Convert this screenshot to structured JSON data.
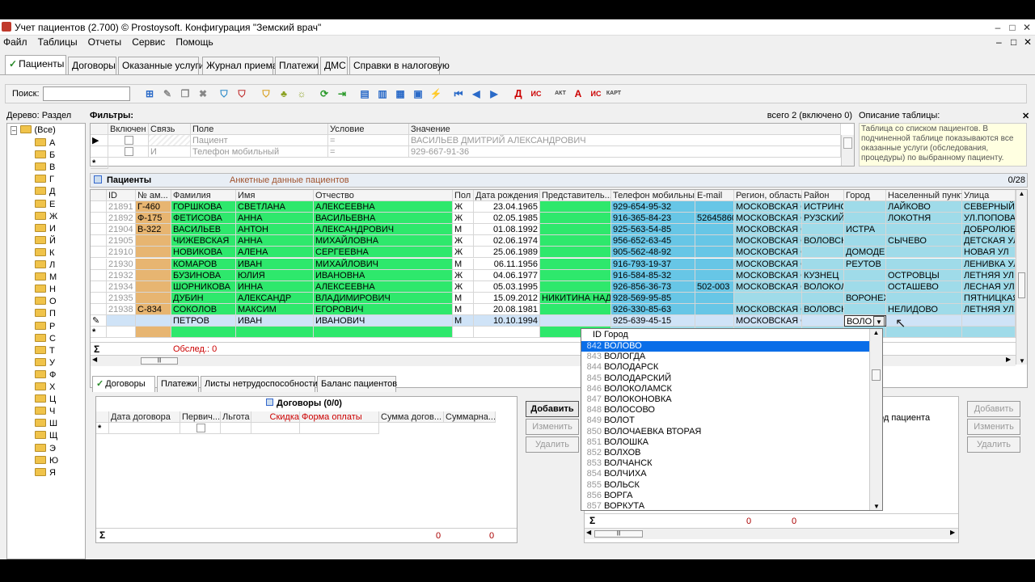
{
  "window": {
    "title": "Учет пациентов (2.700) © Prostoysoft. Конфигурация \"Земский врач\""
  },
  "menu": [
    "Файл",
    "Таблицы",
    "Отчеты",
    "Сервис",
    "Помощь"
  ],
  "tabs": [
    "Пациенты",
    "Договоры",
    "Оказанные услуги",
    "Журнал приема",
    "Платежи",
    "ДМС",
    "Справки в налоговую"
  ],
  "toolbar": {
    "search_label": "Поиск:",
    "search_value": "",
    "text_icons": [
      "Д",
      "ИС",
      "АКТ",
      "А",
      "ИС",
      "КАРТ"
    ]
  },
  "tree": {
    "label": "Дерево: Раздел",
    "root": "(Все)",
    "letters": [
      "А",
      "Б",
      "В",
      "Г",
      "Д",
      "Е",
      "Ж",
      "И",
      "Й",
      "К",
      "Л",
      "М",
      "Н",
      "О",
      "П",
      "Р",
      "С",
      "Т",
      "У",
      "Ф",
      "Х",
      "Ц",
      "Ч",
      "Ш",
      "Щ",
      "Э",
      "Ю",
      "Я"
    ]
  },
  "filters": {
    "label": "Фильтры:",
    "total": "всего 2 (включено 0)",
    "columns": [
      "Включен",
      "Связь",
      "Поле",
      "Условие",
      "Значение"
    ],
    "rows": [
      {
        "link": "",
        "field": "Пациент",
        "cond": "=",
        "value": "ВАСИЛЬЕВ ДМИТРИЙ АЛЕКСАНДРОВИЧ"
      },
      {
        "link": "И",
        "field": "Телефон мобильный",
        "cond": "=",
        "value": "929-667-91-36"
      }
    ]
  },
  "description": {
    "label": "Описание таблицы:",
    "text": "Таблица со списком пациентов. В подчиненной таблице показываются все оказанные услуги (обследования, процедуры) по выбранному пациенту."
  },
  "patients": {
    "title": "Пациенты",
    "subtitle": "Анкетные данные пациентов",
    "counter": "0/28",
    "footer": "Обслед.: 0",
    "columns": [
      "ID",
      "№ ам...",
      "Фамилия",
      "Имя",
      "Отчество",
      "Пол",
      "Дата рождения",
      "Представитель...",
      "Телефон мобильный",
      "E-mail",
      "Регион, область",
      "Район",
      "Город",
      "Населенный пункт",
      "Улица"
    ],
    "rows": [
      [
        "21891",
        "Г-460",
        "ГОРШКОВА",
        "СВЕТЛАНА",
        "АЛЕКСЕЕВНА",
        "Ж",
        "23.04.1965",
        "",
        "929-654-95-32",
        "",
        "МОСКОВСКАЯ С",
        "ИСТРИНС",
        "",
        "ЛАЙКОВО",
        "СЕВЕРНЫЙ Т"
      ],
      [
        "21892",
        "Ф-175",
        "ФЕТИСОВА",
        "АННА",
        "ВАСИЛЬЕВНА",
        "Ж",
        "02.05.1985",
        "",
        "916-365-84-23",
        "52645860",
        "МОСКОВСКАЯ С",
        "РУЗСКИЙ",
        "",
        "ЛОКОТНЯ",
        "УЛ.ПОПОВА"
      ],
      [
        "21904",
        "В-322",
        "ВАСИЛЬЕВ",
        "АНТОН",
        "АЛЕКСАНДРОВИЧ",
        "М",
        "01.08.1992",
        "",
        "925-563-54-85",
        "",
        "МОСКОВСКАЯ С",
        "",
        "ИСТРА",
        "",
        "ДОБРОЛЮБ"
      ],
      [
        "21905",
        "",
        "ЧИЖЕВСКАЯ",
        "АННА",
        "МИХАЙЛОВНА",
        "Ж",
        "02.06.1974",
        "",
        "956-652-63-45",
        "",
        "МОСКОВСКАЯ С",
        "ВОЛОВСК",
        "",
        "СЫЧЕВО",
        "ДЕТСКАЯ УЛ"
      ],
      [
        "21910",
        "",
        "НОВИКОВА",
        "АЛЕНА",
        "СЕРГЕЕВНА",
        "Ж",
        "25.06.1989",
        "",
        "905-562-48-92",
        "",
        "МОСКОВСКАЯ С",
        "",
        "ДОМОДЕ",
        "",
        "НОВАЯ УЛ"
      ],
      [
        "21930",
        "",
        "КОМАРОВ",
        "ИВАН",
        "МИХАЙЛОВИЧ",
        "М",
        "06.11.1956",
        "",
        "916-793-19-37",
        "",
        "МОСКОВСКАЯ С",
        "",
        "РЕУТОВ",
        "",
        "ЛЕНИВКА УЛ"
      ],
      [
        "21932",
        "",
        "БУЗИНОВА",
        "ЮЛИЯ",
        "ИВАНОВНА",
        "Ж",
        "04.06.1977",
        "",
        "916-584-85-32",
        "",
        "МОСКОВСКАЯ С",
        "КУЗНЕЦ",
        "",
        "ОСТРОВЦЫ",
        "ЛЕТНЯЯ УЛ"
      ],
      [
        "21934",
        "",
        "ШОРНИКОВА",
        "ИННА",
        "АЛЕКСЕЕВНА",
        "Ж",
        "05.03.1995",
        "",
        "926-856-36-73",
        "502-003",
        "МОСКОВСКАЯ С",
        "ВОЛОКОЛ",
        "",
        "ОСТАШЕВО",
        "ЛЕСНАЯ УЛ"
      ],
      [
        "21935",
        "",
        "ДУБИН",
        "АЛЕКСАНДР",
        "ВЛАДИМИРОВИЧ",
        "М",
        "15.09.2012",
        "НИКИТИНА НАД",
        "928-569-95-85",
        "",
        "",
        "",
        "ВОРОНЕЖ",
        "",
        "ПЯТНИЦКАЯ"
      ],
      [
        "21938",
        "С-834",
        "СОКОЛОВ",
        "МАКСИМ",
        "ЕГОРОВИЧ",
        "М",
        "20.08.1981",
        "",
        "926-330-85-63",
        "",
        "МОСКОВСКАЯ С",
        "ВОЛОВСК",
        "",
        "НЕЛИДОВО",
        "ЛЕТНЯЯ УЛ"
      ],
      [
        "",
        "",
        "ПЕТРОВ",
        "ИВАН",
        "ИВАНОВИЧ",
        "М",
        "10.10.1994",
        "",
        "925-639-45-15",
        "",
        "МОСКОВСКАЯ С",
        "",
        "ВОЛО",
        "",
        ""
      ]
    ]
  },
  "city_dropdown": {
    "columns": [
      "ID",
      "Город"
    ],
    "rows": [
      [
        "842",
        "ВОЛОВО"
      ],
      [
        "843",
        "ВОЛОГДА"
      ],
      [
        "844",
        "ВОЛОДАРСК"
      ],
      [
        "845",
        "ВОЛОДАРСКИЙ"
      ],
      [
        "846",
        "ВОЛОКОЛАМСК"
      ],
      [
        "847",
        "ВОЛОКОНОВКА"
      ],
      [
        "848",
        "ВОЛОСОВО"
      ],
      [
        "849",
        "ВОЛОТ"
      ],
      [
        "850",
        "ВОЛОЧАЕВКА ВТОРАЯ"
      ],
      [
        "851",
        "ВОЛОШКА"
      ],
      [
        "852",
        "ВОЛХОВ"
      ],
      [
        "853",
        "ВОЛЧАНСК"
      ],
      [
        "854",
        "ВОЛЧИХА"
      ],
      [
        "855",
        "ВОЛЬСК"
      ],
      [
        "856",
        "ВОРГА"
      ],
      [
        "857",
        "ВОРКУТА"
      ]
    ],
    "sum_values": [
      "0",
      "0"
    ]
  },
  "bottom_tabs": [
    "Договоры",
    "Платежи",
    "Листы нетрудоспособности",
    "Баланс пациентов"
  ],
  "contracts": {
    "title": "Договоры (0/0)",
    "columns": [
      "Дата договора",
      "Первич...",
      "Льгота",
      "Скидка",
      "Форма оплаты",
      "Сумма догов...",
      "Суммарна..."
    ],
    "sum": [
      "0",
      "0"
    ]
  },
  "buttons": {
    "add": "Добавить",
    "edit": "Изменить",
    "delete": "Удалить"
  },
  "right_panel": {
    "col": "од пациента"
  },
  "colors": {
    "green": "#2ee86c",
    "orange": "#e7b571",
    "blue": "#67c6e6",
    "light_blue": "#9fdbe9",
    "select": "#0a6ee8"
  }
}
